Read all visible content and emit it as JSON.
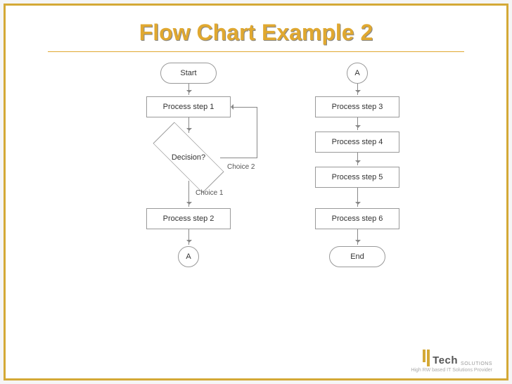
{
  "title": "Flow Chart Example 2",
  "left": {
    "start": "Start",
    "p1": "Process step 1",
    "decision": "Decision?",
    "choice1": "Choice 1",
    "choice2": "Choice 2",
    "p2": "Process step 2",
    "conn": "A"
  },
  "right": {
    "conn": "A",
    "p3": "Process step 3",
    "p4": "Process step 4",
    "p5": "Process step 5",
    "p6": "Process step 6",
    "end": "End"
  },
  "footer": {
    "watermark": "",
    "logo_text": "Tech",
    "logo_small": "SOLUTIONS",
    "tagline": "High RW based IT Solutions Provider"
  }
}
